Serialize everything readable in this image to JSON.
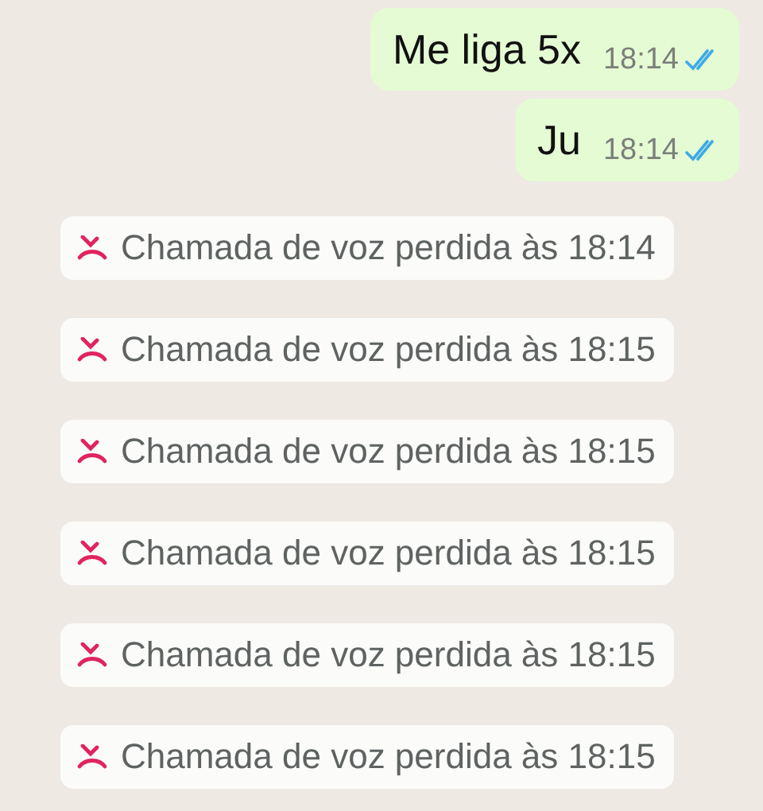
{
  "messages": [
    {
      "text": "Me liga 5x",
      "time": "18:14",
      "read": true
    },
    {
      "text": "Ju",
      "time": "18:14",
      "read": true
    }
  ],
  "missed_calls": [
    {
      "text": "Chamada de voz perdida às 18:14"
    },
    {
      "text": "Chamada de voz perdida às 18:15"
    },
    {
      "text": "Chamada de voz perdida às 18:15"
    },
    {
      "text": "Chamada de voz perdida às 18:15"
    },
    {
      "text": "Chamada de voz perdida às 18:15"
    },
    {
      "text": "Chamada de voz perdida às 18:15"
    }
  ]
}
